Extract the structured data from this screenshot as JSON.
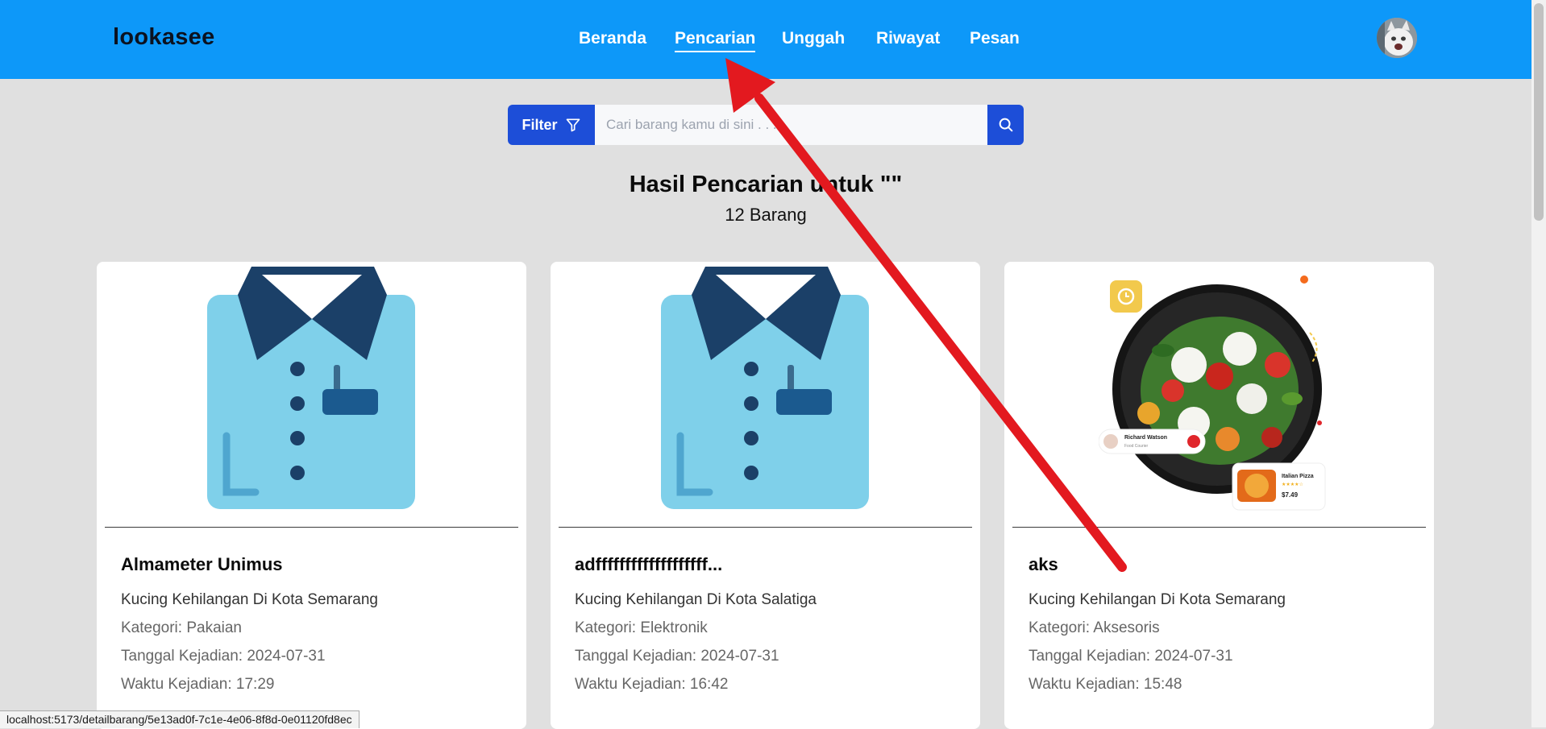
{
  "header": {
    "brand": "lookasee",
    "nav": [
      {
        "label": "Beranda",
        "active": false
      },
      {
        "label": "Pencarian",
        "active": true
      },
      {
        "label": "Unggah",
        "active": false
      },
      {
        "label": "Riwayat",
        "active": false
      },
      {
        "label": "Pesan",
        "active": false
      }
    ],
    "avatar_icon": "cat-avatar"
  },
  "search": {
    "filter_label": "Filter",
    "filter_icon": "funnel-icon",
    "placeholder": "Cari barang kamu di sini . . .",
    "value": "",
    "button_icon": "search-icon"
  },
  "results": {
    "title": "Hasil Pencarian untuk \"\"",
    "count": "12 Barang"
  },
  "cards": [
    {
      "image": "shirt-illustration",
      "title": "Almameter Unimus",
      "location": "Kucing Kehilangan Di Kota Semarang",
      "category": "Kategori: Pakaian",
      "date": "Tanggal Kejadian: 2024-07-31",
      "time": "Waktu Kejadian: 17:29"
    },
    {
      "image": "shirt-illustration",
      "title": "adfffffffffffffffffff...",
      "location": "Kucing Kehilangan Di Kota Salatiga",
      "category": "Kategori: Elektronik",
      "date": "Tanggal Kejadian: 2024-07-31",
      "time": "Waktu Kejadian: 16:42"
    },
    {
      "image": "salad-bowl-promo",
      "title": "aks",
      "location": "Kucing Kehilangan Di Kota Semarang",
      "category": "Kategori: Aksesoris",
      "date": "Tanggal Kejadian: 2024-07-31",
      "time": "Waktu Kejadian: 15:48",
      "image_texts": {
        "courier_name": "Richard Watson",
        "courier_role": "Food Courier",
        "pizza_name": "Italian Pizza",
        "pizza_price": "$7.49"
      }
    }
  ],
  "status_bar": {
    "url": "localhost:5173/detailbarang/5e13ad0f-7c1e-4e06-8f8d-0e01120fd8ec"
  },
  "colors": {
    "navbar": "#0d98f9",
    "primary_button": "#1d4ed8",
    "page_background": "#e0e0e0",
    "annotation_arrow": "#e3191f"
  }
}
